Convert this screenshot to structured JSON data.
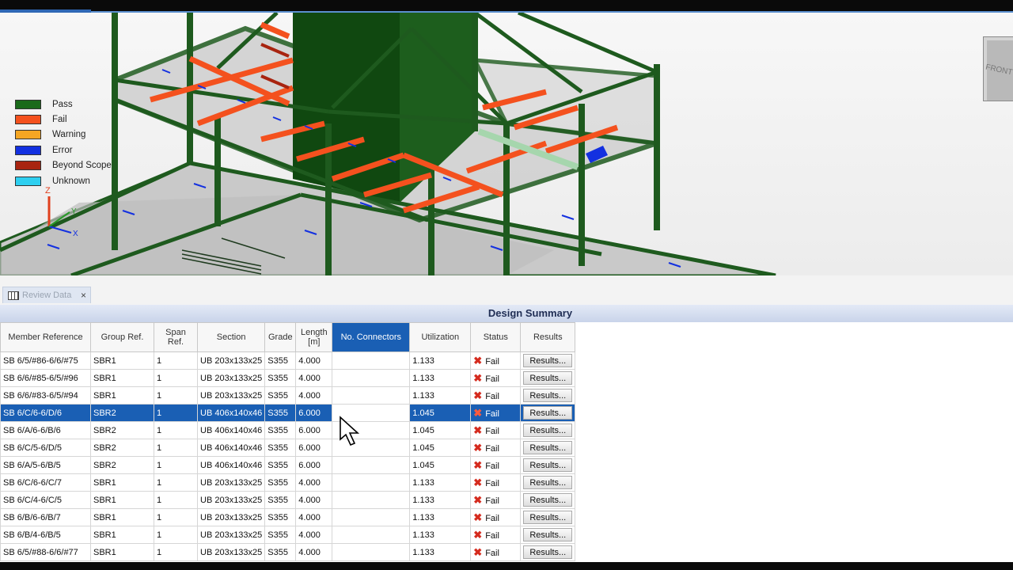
{
  "legend": [
    {
      "label": "Pass",
      "color": "#1a6a1a"
    },
    {
      "label": "Fail",
      "color": "#f4511e"
    },
    {
      "label": "Warning",
      "color": "#f5a623"
    },
    {
      "label": "Error",
      "color": "#1330e0"
    },
    {
      "label": "Beyond Scope",
      "color": "#a82410"
    },
    {
      "label": "Unknown",
      "color": "#2ecff0"
    }
  ],
  "viewcube": {
    "face_label": "FRONT"
  },
  "axes": {
    "z": "Z",
    "y": "Y",
    "x": "X"
  },
  "tab": {
    "label": "Review Data",
    "close": "×"
  },
  "summary": {
    "title": "Design Summary"
  },
  "table": {
    "headers": {
      "member": "Member Reference",
      "group": "Group Ref.",
      "span": "Span Ref.",
      "section": "Section",
      "grade": "Grade",
      "length": "Length [m]",
      "connectors": "No. Connectors",
      "utilization": "Utilization",
      "status": "Status",
      "results": "Results"
    },
    "rows": [
      {
        "member": "SB 6/5/#86-6/6/#75",
        "group": "SBR1",
        "span": "1",
        "section": "UB 203x133x25",
        "grade": "S355",
        "length": "4.000",
        "connectors": "",
        "utilization": "1.133",
        "status": "Fail",
        "results": "Results..."
      },
      {
        "member": "SB 6/6/#85-6/5/#96",
        "group": "SBR1",
        "span": "1",
        "section": "UB 203x133x25",
        "grade": "S355",
        "length": "4.000",
        "connectors": "",
        "utilization": "1.133",
        "status": "Fail",
        "results": "Results..."
      },
      {
        "member": "SB 6/6/#83-6/5/#94",
        "group": "SBR1",
        "span": "1",
        "section": "UB 203x133x25",
        "grade": "S355",
        "length": "4.000",
        "connectors": "",
        "utilization": "1.133",
        "status": "Fail",
        "results": "Results..."
      },
      {
        "member": "SB 6/C/6-6/D/6",
        "group": "SBR2",
        "span": "1",
        "section": "UB 406x140x46",
        "grade": "S355",
        "length": "6.000",
        "connectors": "",
        "utilization": "1.045",
        "status": "Fail",
        "results": "Results...",
        "selected": true
      },
      {
        "member": "SB 6/A/6-6/B/6",
        "group": "SBR2",
        "span": "1",
        "section": "UB 406x140x46",
        "grade": "S355",
        "length": "6.000",
        "connectors": "",
        "utilization": "1.045",
        "status": "Fail",
        "results": "Results..."
      },
      {
        "member": "SB 6/C/5-6/D/5",
        "group": "SBR2",
        "span": "1",
        "section": "UB 406x140x46",
        "grade": "S355",
        "length": "6.000",
        "connectors": "",
        "utilization": "1.045",
        "status": "Fail",
        "results": "Results..."
      },
      {
        "member": "SB 6/A/5-6/B/5",
        "group": "SBR2",
        "span": "1",
        "section": "UB 406x140x46",
        "grade": "S355",
        "length": "6.000",
        "connectors": "",
        "utilization": "1.045",
        "status": "Fail",
        "results": "Results..."
      },
      {
        "member": "SB 6/C/6-6/C/7",
        "group": "SBR1",
        "span": "1",
        "section": "UB 203x133x25",
        "grade": "S355",
        "length": "4.000",
        "connectors": "",
        "utilization": "1.133",
        "status": "Fail",
        "results": "Results..."
      },
      {
        "member": "SB 6/C/4-6/C/5",
        "group": "SBR1",
        "span": "1",
        "section": "UB 203x133x25",
        "grade": "S355",
        "length": "4.000",
        "connectors": "",
        "utilization": "1.133",
        "status": "Fail",
        "results": "Results..."
      },
      {
        "member": "SB 6/B/6-6/B/7",
        "group": "SBR1",
        "span": "1",
        "section": "UB 203x133x25",
        "grade": "S355",
        "length": "4.000",
        "connectors": "",
        "utilization": "1.133",
        "status": "Fail",
        "results": "Results..."
      },
      {
        "member": "SB 6/B/4-6/B/5",
        "group": "SBR1",
        "span": "1",
        "section": "UB 203x133x25",
        "grade": "S355",
        "length": "4.000",
        "connectors": "",
        "utilization": "1.133",
        "status": "Fail",
        "results": "Results..."
      },
      {
        "member": "SB 6/5/#88-6/6/#77",
        "group": "SBR1",
        "span": "1",
        "section": "UB 203x133x25",
        "grade": "S355",
        "length": "4.000",
        "connectors": "",
        "utilization": "1.133",
        "status": "Fail",
        "results": "Results..."
      }
    ]
  }
}
